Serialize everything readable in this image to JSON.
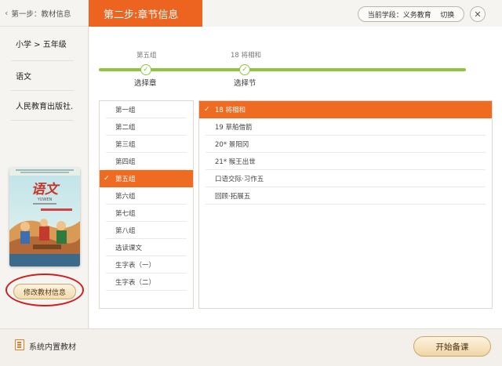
{
  "left_header": {
    "back_icon": "chevron-left-icon",
    "title": "第一步：教材信息"
  },
  "left_items": [
    "小学 > 五年级",
    "语文",
    "人民教育出版社..."
  ],
  "book": {
    "title": "语文",
    "pinyin": "YUWEN",
    "icon": "textbook-cover-image"
  },
  "modify_button": "修改教材信息",
  "step2_title": "第二步:章节信息",
  "school": {
    "label": "当前学段：义务教育",
    "switch": "切换"
  },
  "close_icon": "close-icon",
  "progress": {
    "step1": {
      "top": "第五组",
      "bottom": "选择章"
    },
    "step2": {
      "top": "18 将相和",
      "bottom": "选择节"
    }
  },
  "groups": [
    "第一组",
    "第二组",
    "第三组",
    "第四组",
    "第五组",
    "第六组",
    "第七组",
    "第八组",
    "选读课文",
    "生字表（一）",
    "生字表（二）"
  ],
  "selected_group": "第五组",
  "lessons": [
    "18 将相和",
    "19 草船借箭",
    "20* 景阳冈",
    "21* 猴王出世",
    "口语交际·习作五",
    "回顾·拓展五"
  ],
  "selected_lesson": "18 将相和",
  "footer": {
    "icon": "book-list-icon",
    "label": "系统内置教材",
    "start_button": "开始备课"
  },
  "colors": {
    "accent": "#ef6b22",
    "progress": "#8fc43e",
    "highlight_circle": "#d01e1e"
  }
}
